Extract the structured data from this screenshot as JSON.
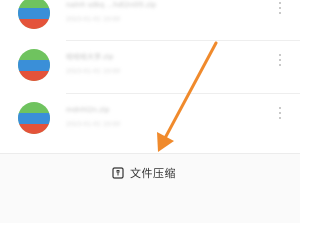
{
  "files": [
    {
      "name": "nalnh sdkq ...hdl2n0l5.zip",
      "meta": "2023-01-01 10:00",
      "icon": "compressed-file-icon"
    },
    {
      "name": "哈哈哈大学.zip",
      "meta": "2023-01-01 10:00",
      "icon": "compressed-file-icon"
    },
    {
      "name": "mdnhl2n.zip",
      "meta": "2023-01-01 10:00",
      "icon": "compressed-file-icon"
    }
  ],
  "bottom_action": {
    "label": "文件压缩",
    "icon": "zip-icon"
  },
  "annotation": {
    "icon": "arrow-pointer-icon",
    "color": "#f08a2c"
  },
  "colors": {
    "icon_green": "#6fc35f",
    "icon_blue": "#3a8fd8",
    "icon_red": "#e4533a"
  }
}
